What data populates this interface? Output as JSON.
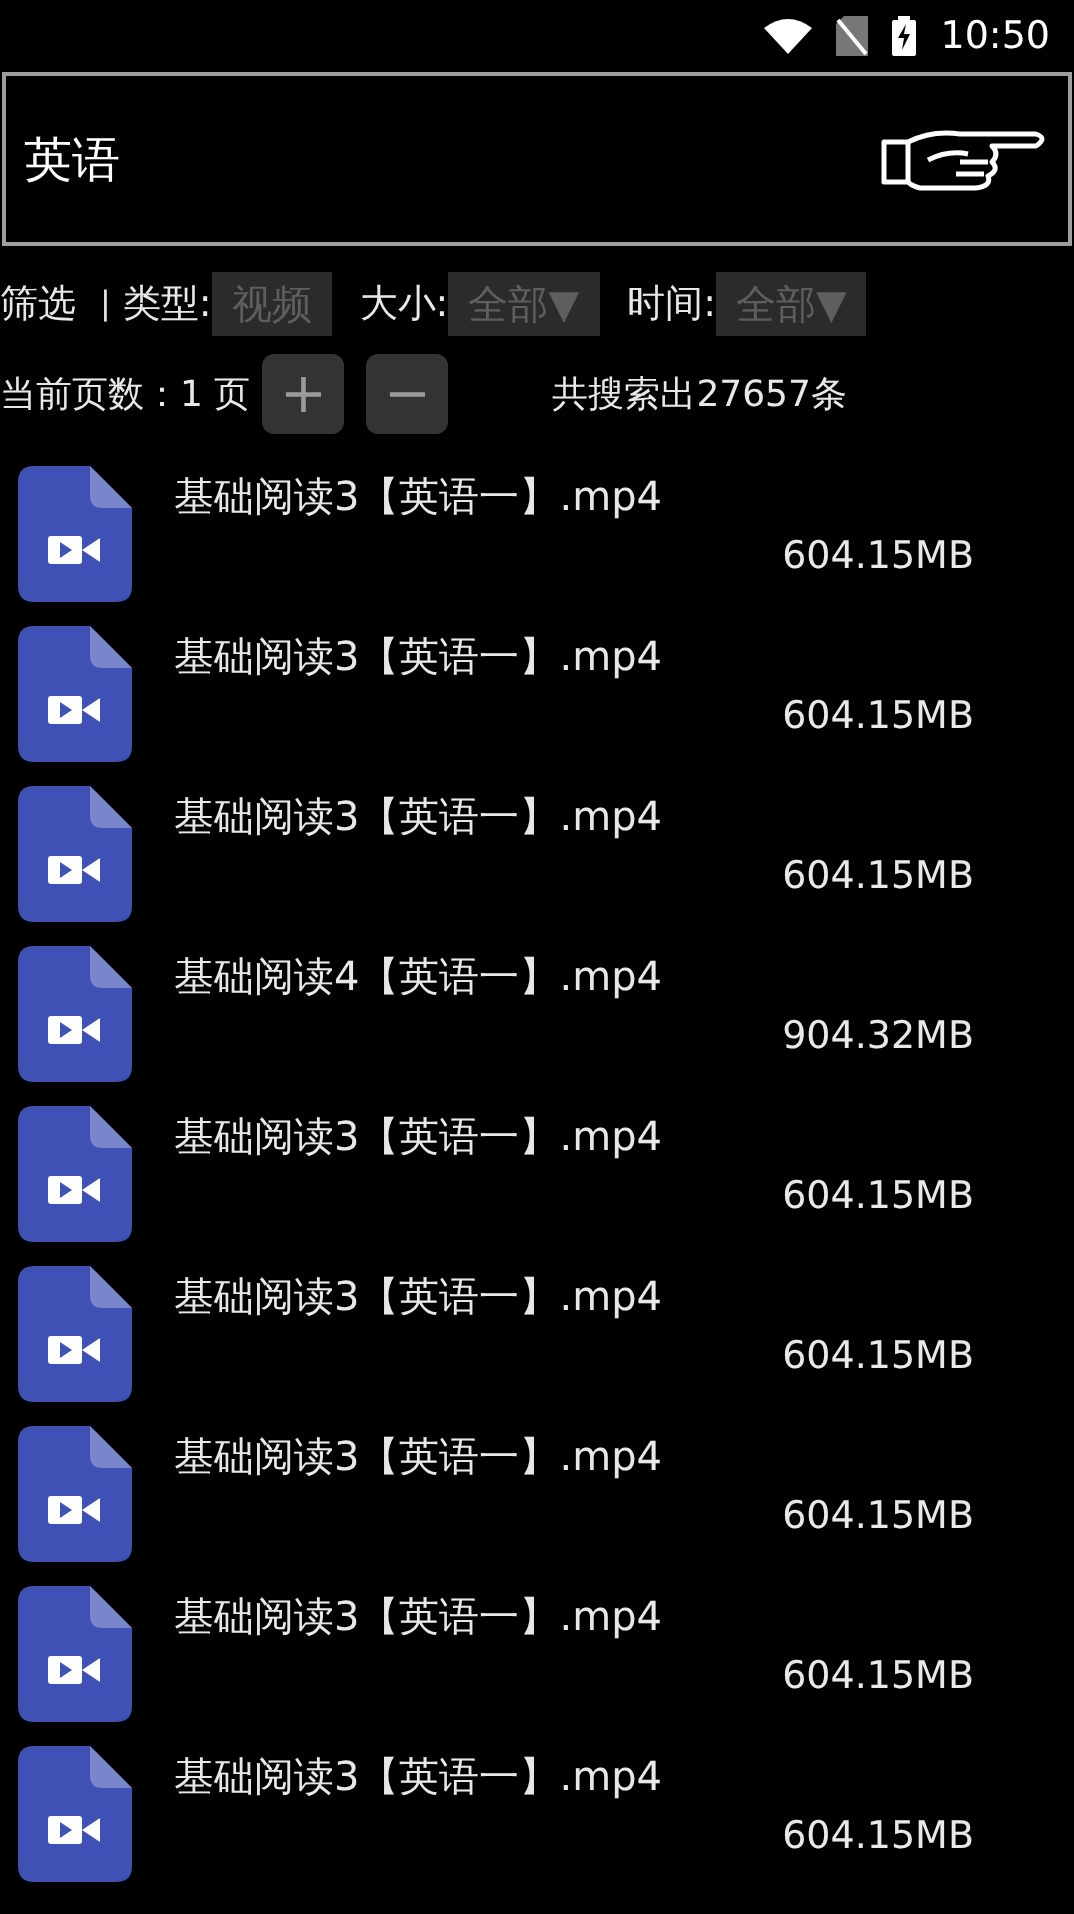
{
  "status_bar": {
    "time": "10:50"
  },
  "search": {
    "value": "英语"
  },
  "filters": {
    "label": "筛选",
    "separator": "|",
    "items": [
      {
        "label": "类型:",
        "value": "视频"
      },
      {
        "label": "大小:",
        "value": "全部▼"
      },
      {
        "label": "时间:",
        "value": "全部▼"
      }
    ]
  },
  "pager": {
    "label": "当前页数：1 页",
    "plus": "+",
    "minus": "−",
    "total": "共搜索出27657条"
  },
  "files": [
    {
      "name": "基础阅读3【英语一】.mp4",
      "size": "604.15MB"
    },
    {
      "name": "基础阅读3【英语一】.mp4",
      "size": "604.15MB"
    },
    {
      "name": "基础阅读3【英语一】.mp4",
      "size": "604.15MB"
    },
    {
      "name": "基础阅读4【英语一】.mp4",
      "size": "904.32MB"
    },
    {
      "name": "基础阅读3【英语一】.mp4",
      "size": "604.15MB"
    },
    {
      "name": "基础阅读3【英语一】.mp4",
      "size": "604.15MB"
    },
    {
      "name": "基础阅读3【英语一】.mp4",
      "size": "604.15MB"
    },
    {
      "name": "基础阅读3【英语一】.mp4",
      "size": "604.15MB"
    },
    {
      "name": "基础阅读3【英语一】.mp4",
      "size": "604.15MB"
    }
  ]
}
